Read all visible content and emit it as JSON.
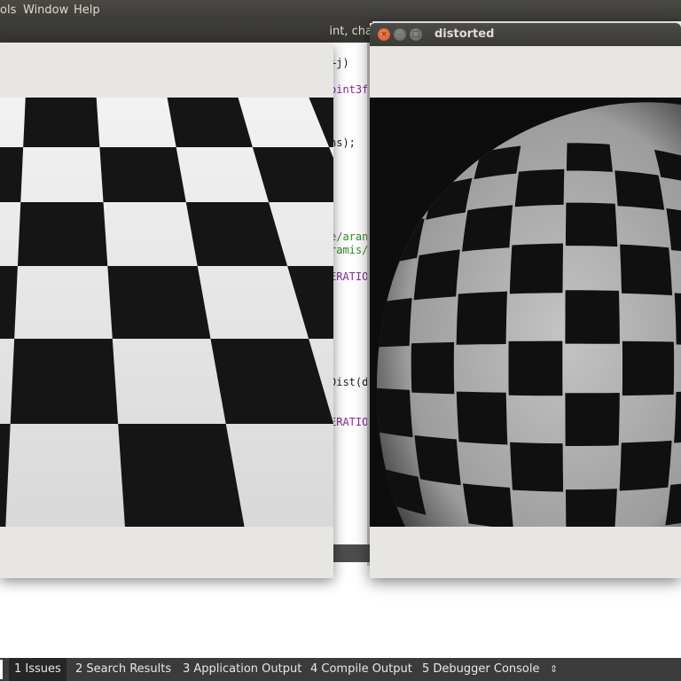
{
  "menubar": {
    "items": [
      "ols",
      "Window",
      "Help"
    ]
  },
  "editor": {
    "title_fragment": "int, cha",
    "code_lines": [
      {
        "text": "+j)",
        "color": "#202020"
      },
      {
        "text": "oint3f",
        "color": "#8a2a9a"
      },
      {
        "text": "ns);",
        "color": "#202020"
      },
      {
        "text": "e/aran",
        "color": "#2e8b2e"
      },
      {
        "text": "ramis/",
        "color": "#2e8b2e"
      },
      {
        "text": "ERATIO",
        "color": "#8a2a9a"
      },
      {
        "text": "Dist(d",
        "color": "#202020"
      },
      {
        "text": "ERATIO",
        "color": "#8a2a9a"
      }
    ]
  },
  "distorted_window": {
    "title": "distorted",
    "close_glyph": "×",
    "min_glyph": "–",
    "max_glyph": "□"
  },
  "bottom_tabs": [
    {
      "label": "1  Issues",
      "active": true
    },
    {
      "label": "2  Search Results",
      "active": false
    },
    {
      "label": "3  Application Output",
      "active": false
    },
    {
      "label": "4  Compile Output",
      "active": false
    },
    {
      "label": "5  Debugger Console",
      "active": false
    }
  ],
  "bottom_tabs_arrow": "⇕",
  "icons": {
    "close": "close-icon",
    "minimize": "minimize-icon",
    "maximize": "maximize-icon",
    "tabs_menu": "up-down-arrow-icon"
  },
  "colors": {
    "close_button": "#e0622f",
    "title_bar": "#3c3b37",
    "bottom_bar": "#3b3b3b"
  }
}
